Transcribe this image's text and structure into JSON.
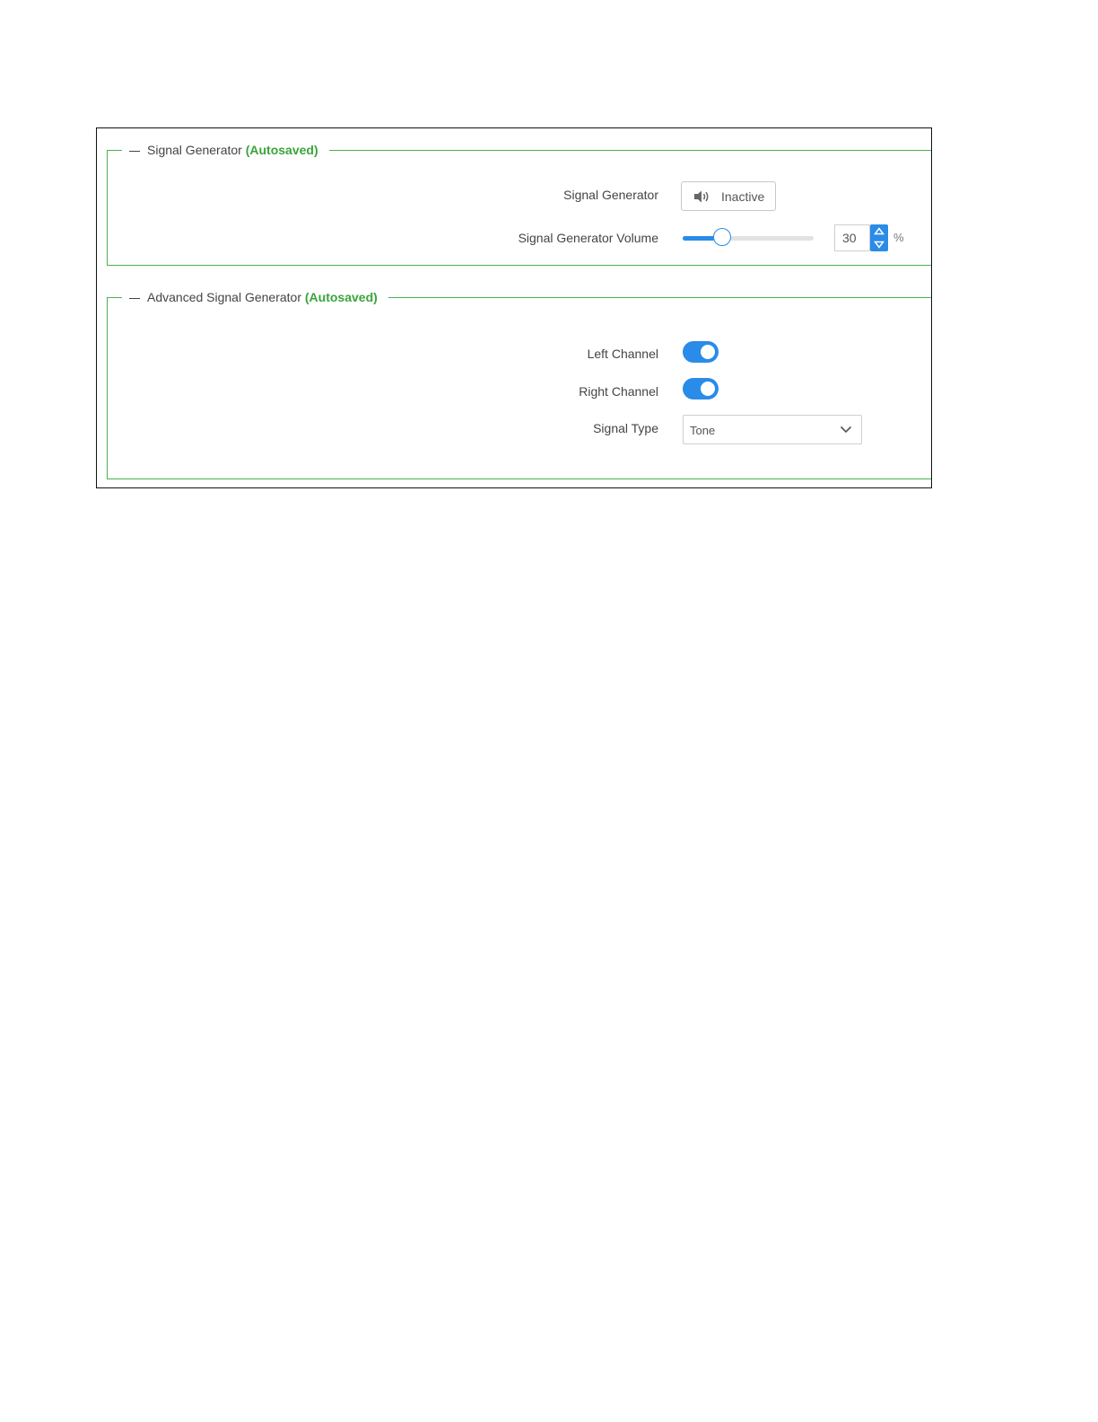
{
  "signal_generator": {
    "legend": "Signal Generator",
    "autosaved": "(Autosaved)",
    "signal_generator_label": "Signal Generator",
    "signal_generator_button": "Inactive",
    "volume_label": "Signal Generator Volume",
    "volume_value": "30",
    "volume_percent": 30,
    "volume_unit": "%"
  },
  "advanced": {
    "legend": "Advanced Signal Generator",
    "autosaved": "(Autosaved)",
    "left_channel_label": "Left Channel",
    "left_channel_on": true,
    "right_channel_label": "Right Channel",
    "right_channel_on": true,
    "signal_type_label": "Signal Type",
    "signal_type_value": "Tone"
  },
  "colors": {
    "accent": "#2a8be8",
    "fieldset_border": "#4cb050",
    "autosaved_text": "#3aa43a"
  },
  "icons": {
    "signal_button": "speaker-icon",
    "select": "chevron-down-icon",
    "spin_up": "triangle-up-icon",
    "spin_down": "triangle-down-icon"
  }
}
